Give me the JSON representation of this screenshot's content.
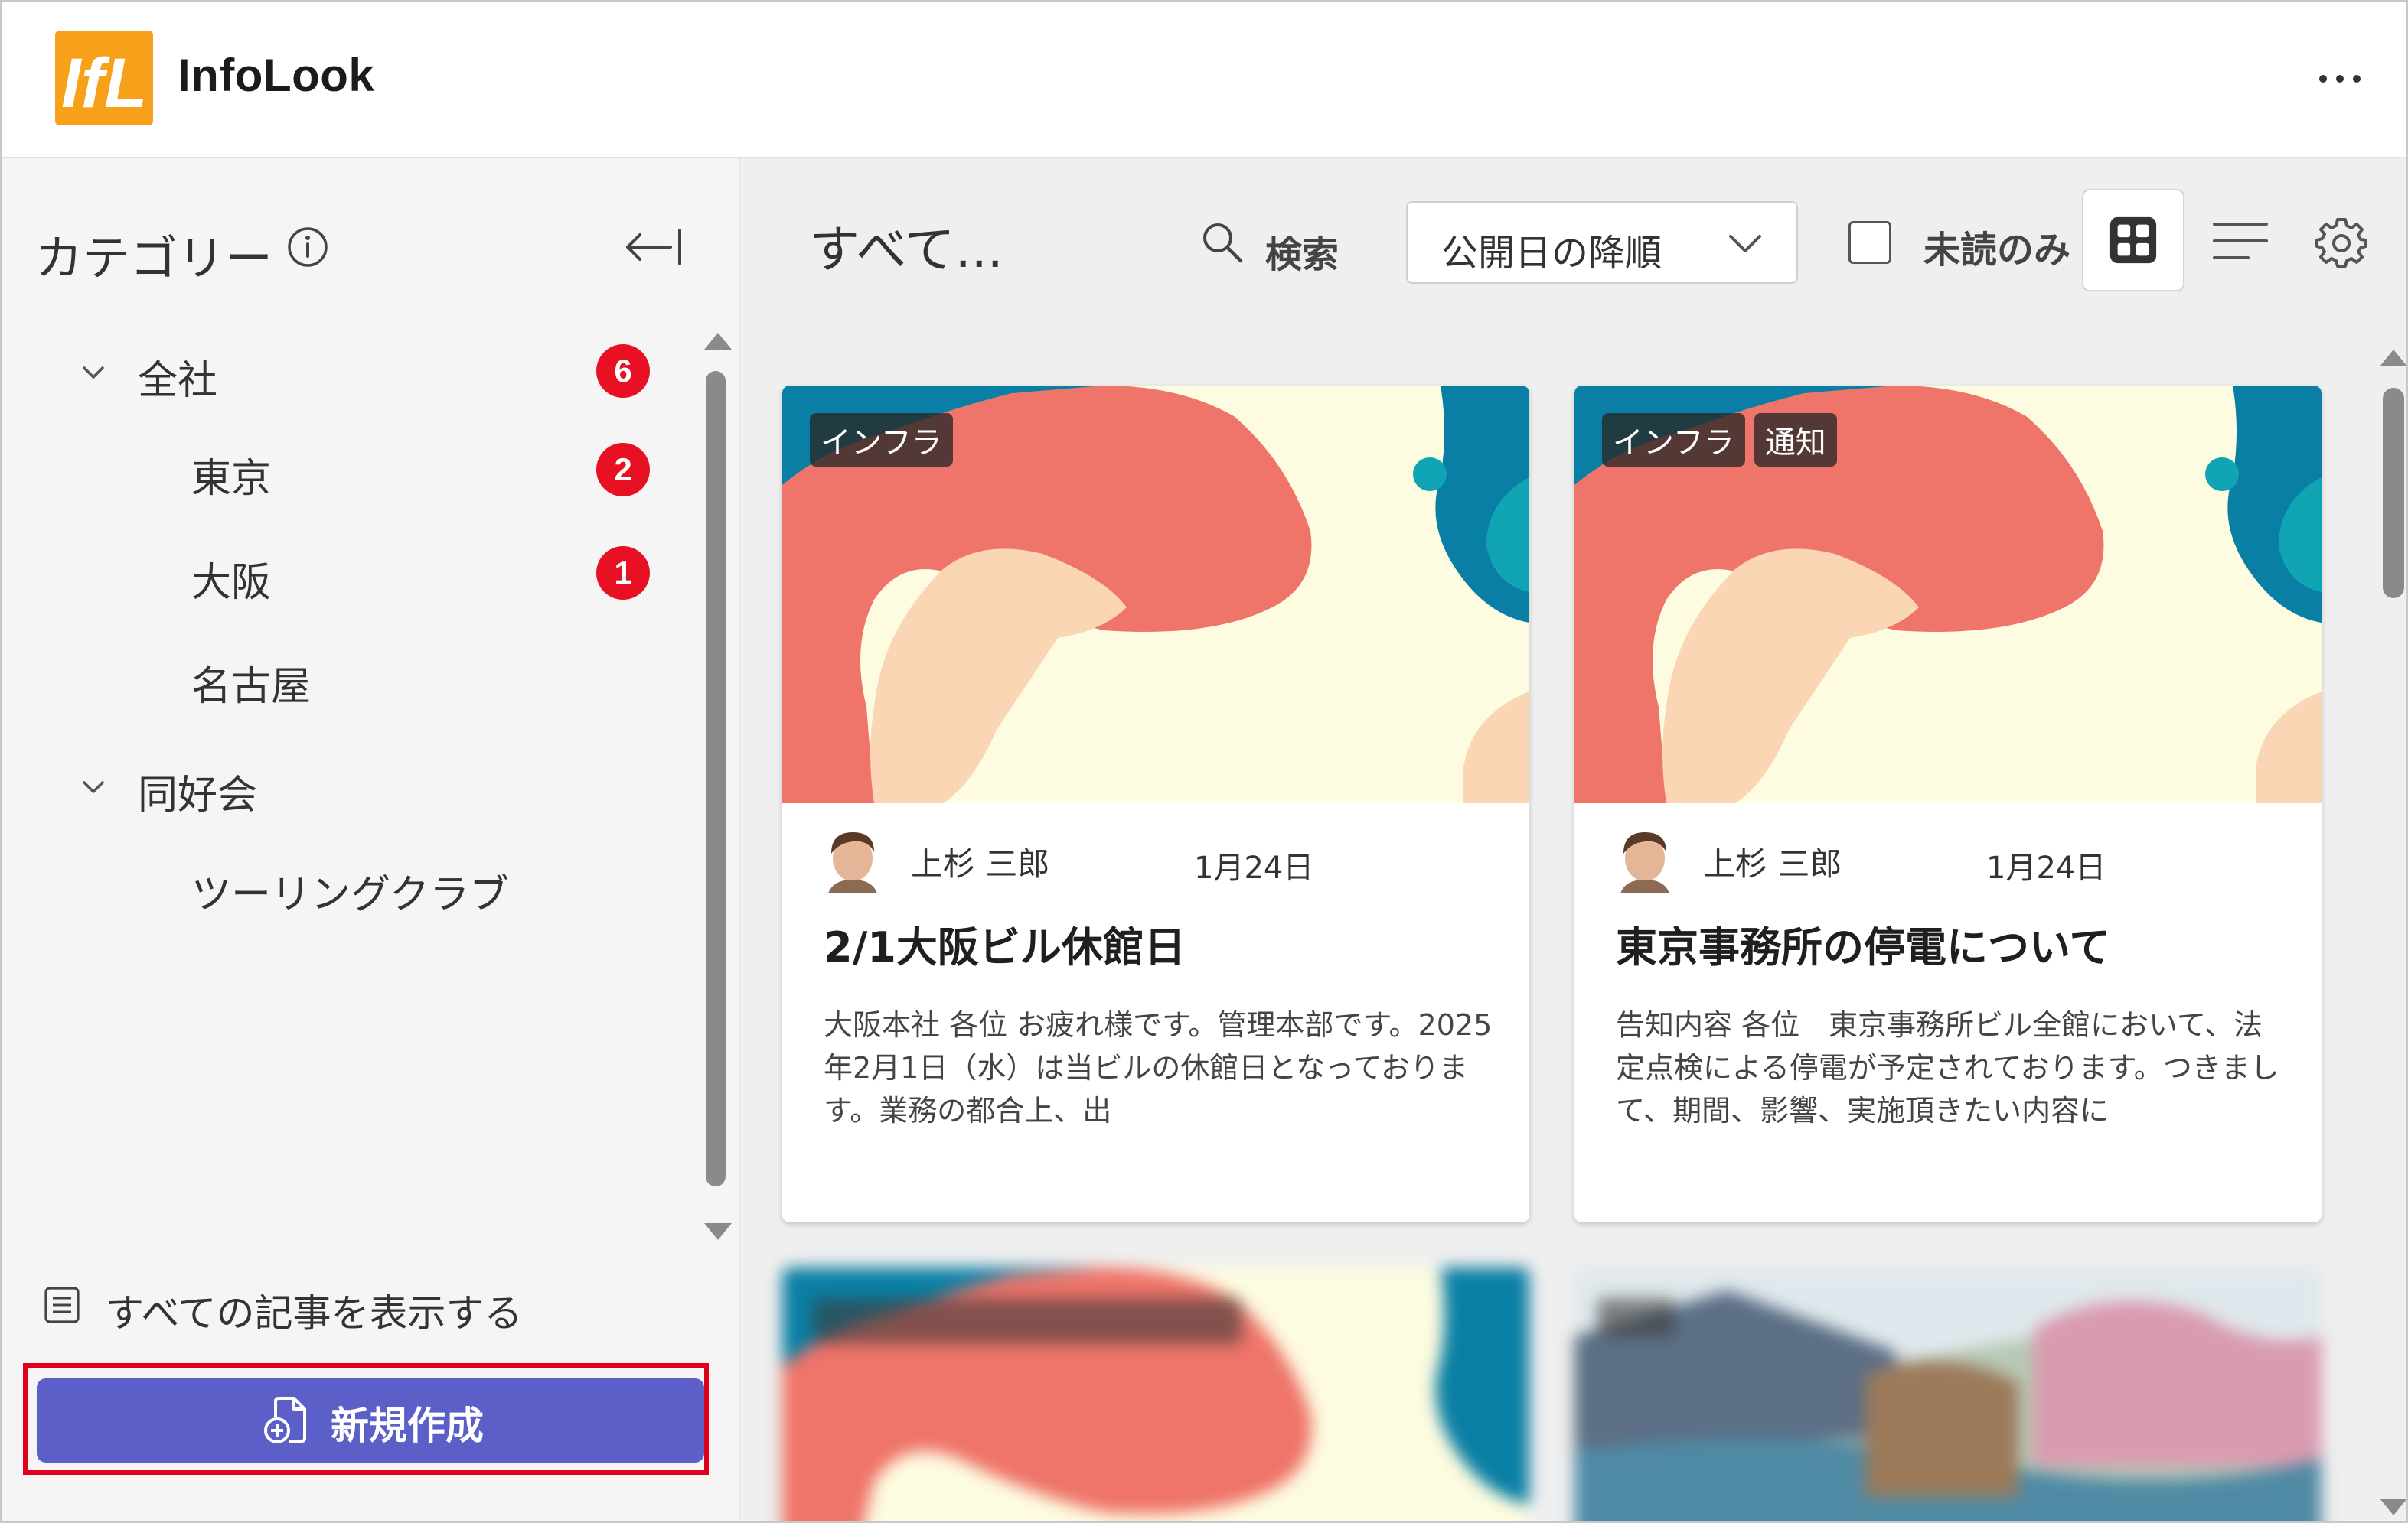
{
  "app": {
    "name": "InfoLook",
    "logo_text": "IfL"
  },
  "sidebar": {
    "title": "カテゴリー",
    "tree": [
      {
        "label": "全社",
        "badge": "6",
        "expanded": true
      },
      {
        "label": "東京",
        "badge": "2"
      },
      {
        "label": "大阪",
        "badge": "1"
      },
      {
        "label": "名古屋"
      },
      {
        "label": "同好会",
        "expanded": true
      },
      {
        "label": "ツーリングクラブ"
      }
    ],
    "show_all_label": "すべての記事を表示する",
    "new_button_label": "新規作成"
  },
  "toolbar": {
    "title": "すべて...",
    "search_label": "検索",
    "sort_label": "公開日の降順",
    "unread_label": "未読のみ"
  },
  "cards": [
    {
      "tags": [
        "インフラ"
      ],
      "author": "上杉 三郎",
      "date": "1月24日",
      "title": "2/1大阪ビル休館日",
      "excerpt": "大阪本社 各位 お疲れ様です。管理本部です。2025年2月1日（水）は当ビルの休館日となっております。業務の都合上、出"
    },
    {
      "tags": [
        "インフラ",
        "通知"
      ],
      "author": "上杉 三郎",
      "date": "1月24日",
      "title": "東京事務所の停電について",
      "excerpt": "告知内容 各位　東京事務所ビル全館において、法定点検による停電が予定されております。つきまして、期間、影響、実施頂きたい内容に"
    }
  ],
  "colors": {
    "accent": "#5b5fc7",
    "badge": "#e81123",
    "highlight_outline": "#e0001b",
    "logo_orange": "#f7a11a",
    "hero_cream": "#fdfbe0",
    "hero_coral": "#ef7469",
    "hero_peach": "#fbd6b4",
    "hero_teal": "#0a7fa5"
  }
}
